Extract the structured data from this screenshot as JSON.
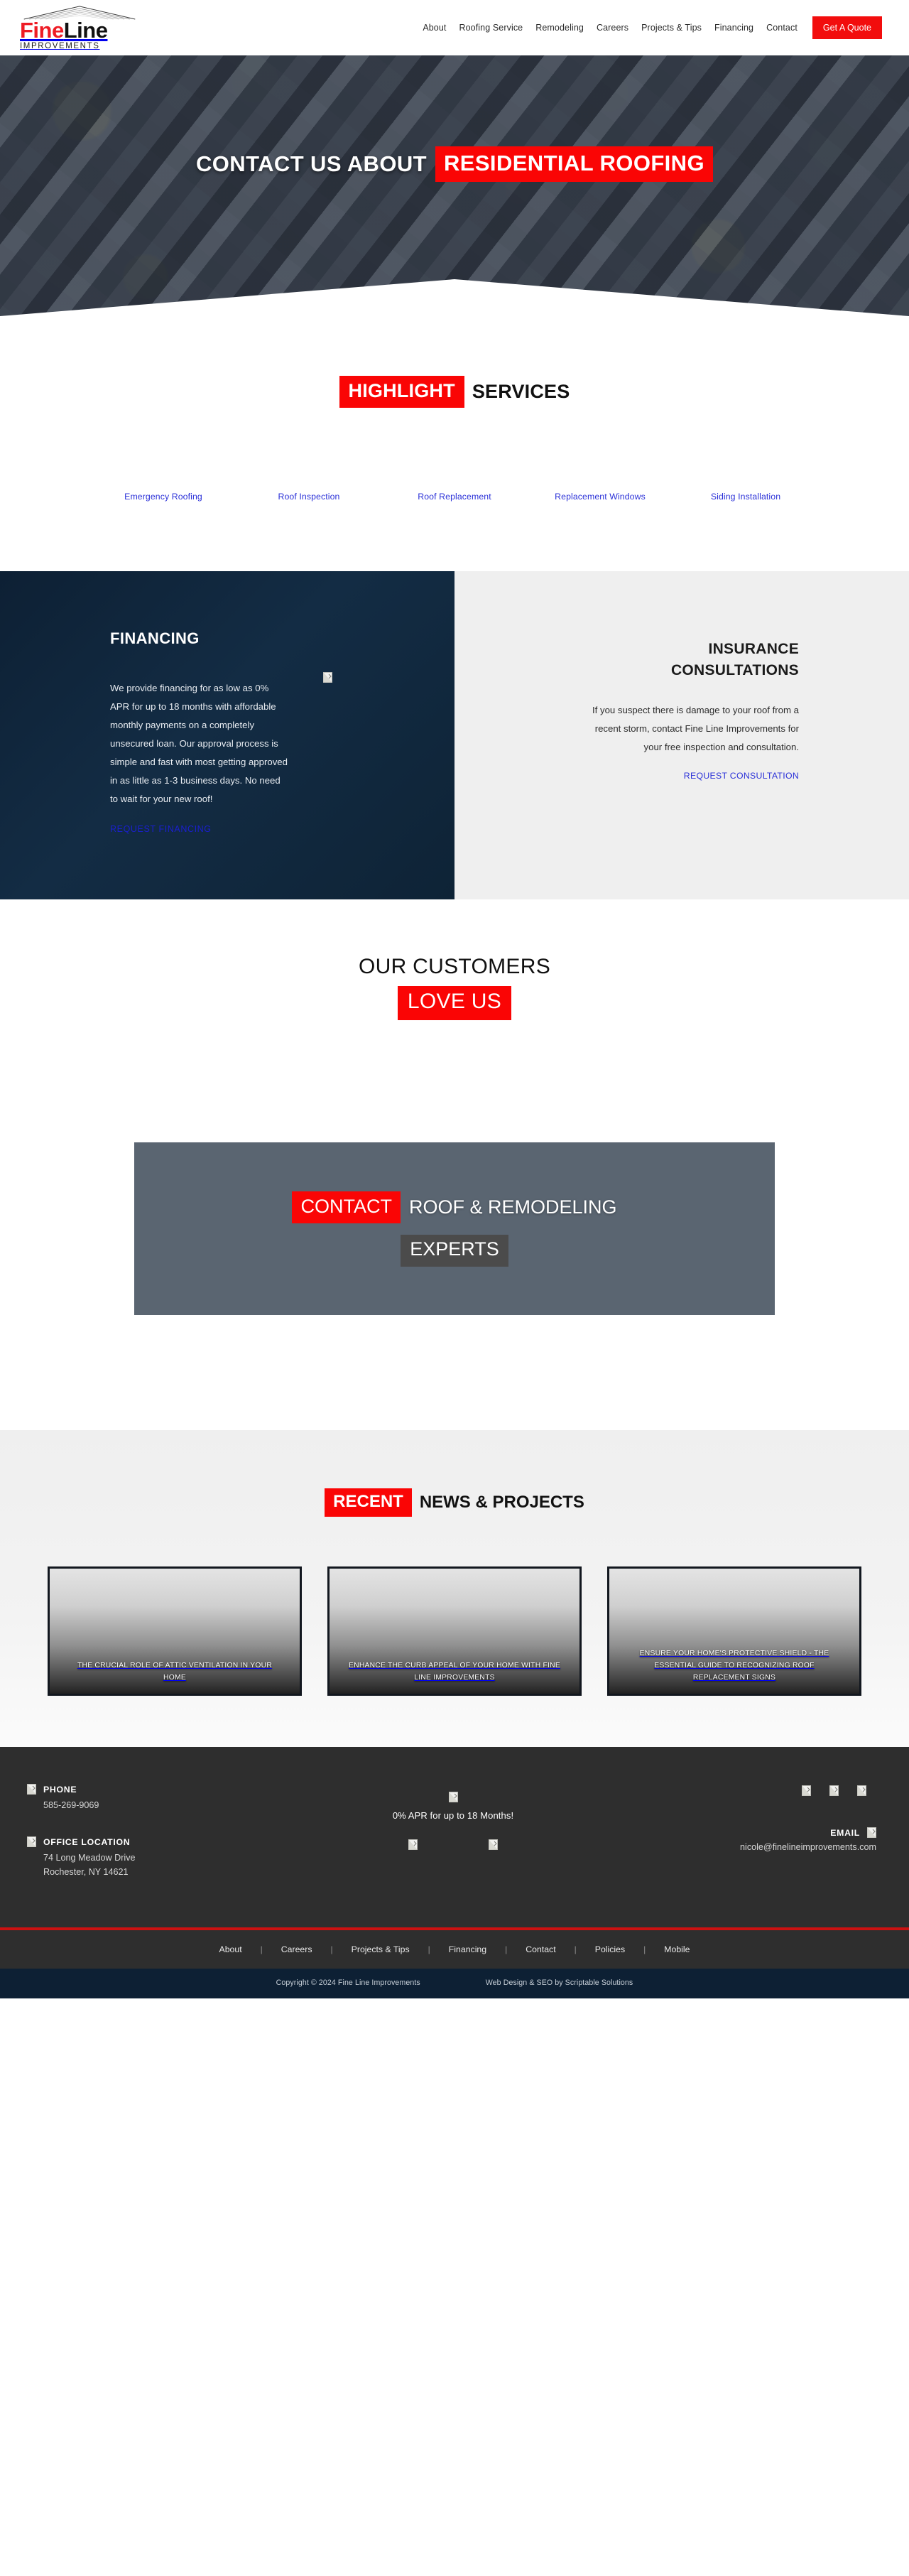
{
  "brand": {
    "logo_fine": "Fine",
    "logo_line": "Line",
    "logo_sub": "IMPROVEMENTS",
    "accent_red": "#fa0505",
    "dark_navy": "#0d2034",
    "footer_gray": "#2e2e2e"
  },
  "nav": {
    "items": [
      {
        "label": "About"
      },
      {
        "label": "Roofing Service"
      },
      {
        "label": "Remodeling"
      },
      {
        "label": "Careers"
      },
      {
        "label": "Projects & Tips"
      },
      {
        "label": "Financing"
      },
      {
        "label": "Contact"
      }
    ],
    "cta_label": "Get A Quote"
  },
  "hero": {
    "title_white": "CONTACT US ABOUT",
    "title_red": "RESIDENTIAL ROOFING"
  },
  "services": {
    "heading_highlight": "HIGHLIGHT",
    "heading_rest": "SERVICES",
    "links": [
      {
        "label": "Emergency Roofing"
      },
      {
        "label": "Roof Inspection"
      },
      {
        "label": "Roof Replacement"
      },
      {
        "label": "Replacement Windows"
      },
      {
        "label": "Siding Installation"
      }
    ]
  },
  "financing": {
    "heading": "FINANCING",
    "body": "We provide financing for as low as 0% APR for up to 18 months with affordable monthly payments on a completely unsecured loan. Our approval process is simple and fast with most getting approved in as little as 1-3 business days. No need to wait for your new roof!",
    "link_label": "REQUEST FINANCING"
  },
  "insurance": {
    "heading_line1": "INSURANCE",
    "heading_line2": "CONSULTATIONS",
    "body": "If you suspect there is damage to your roof from a recent storm, contact Fine Line Improvements for your free inspection and consultation.",
    "link_label": "REQUEST CONSULTATION"
  },
  "love": {
    "line1": "OUR CUSTOMERS",
    "line2": "LOVE US"
  },
  "experts": {
    "red": "CONTACT",
    "white": "ROOF & REMODELING",
    "dark": "EXPERTS"
  },
  "news": {
    "heading_highlight": "RECENT",
    "heading_rest": "NEWS & PROJECTS",
    "cards": [
      {
        "title": "THE CRUCIAL ROLE OF ATTIC VENTILATION IN YOUR HOME"
      },
      {
        "title": "ENHANCE THE CURB APPEAL OF YOUR HOME WITH FINE LINE IMPROVEMENTS"
      },
      {
        "title": "ENSURE YOUR HOME'S PROTECTIVE SHIELD - THE ESSENTIAL GUIDE TO RECOGNIZING ROOF REPLACEMENT SIGNS"
      }
    ]
  },
  "footer": {
    "phone_label": "PHONE",
    "phone_value": "585-269-9069",
    "office_label": "OFFICE LOCATION",
    "office_line1": "74 Long Meadow Drive",
    "office_line2": "Rochester, NY 14621",
    "apr_text": "0% APR for up to 18 Months!",
    "email_label": "EMAIL",
    "email_value": "nicole@finelineimprovements.com",
    "nav": [
      {
        "label": "About"
      },
      {
        "label": "Careers"
      },
      {
        "label": "Projects & Tips"
      },
      {
        "label": "Financing"
      },
      {
        "label": "Contact"
      },
      {
        "label": "Policies"
      },
      {
        "label": "Mobile"
      }
    ],
    "separator": "|",
    "copyright": "Copyright © 2024 Fine Line Improvements",
    "credit": "Web Design & SEO by Scriptable Solutions"
  },
  "icons": {
    "broken_image": "broken-image-icon",
    "phone": "phone-icon",
    "location": "location-pin-icon",
    "email": "email-icon"
  }
}
